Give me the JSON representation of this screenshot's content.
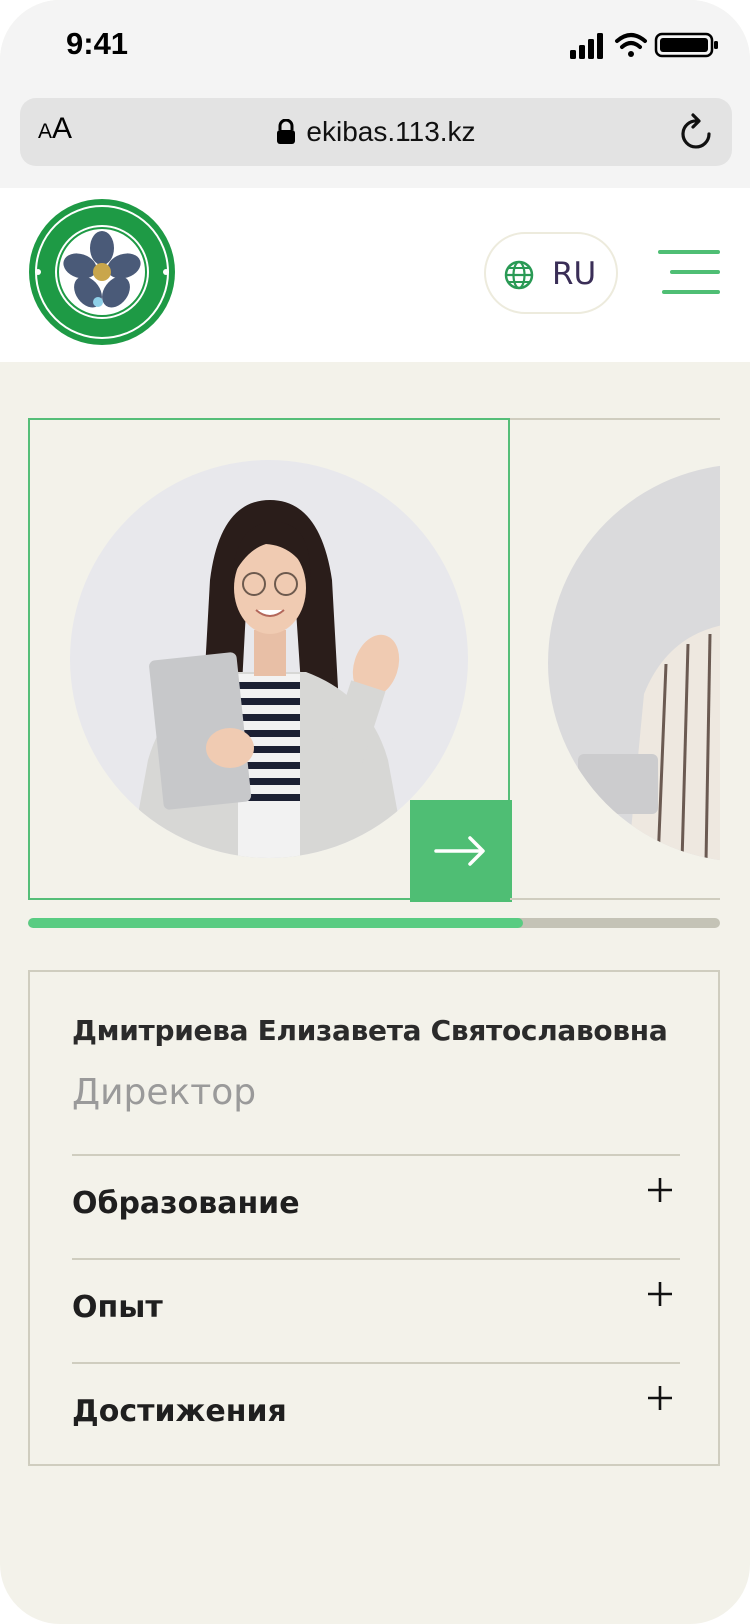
{
  "status": {
    "time": "9:41"
  },
  "browser": {
    "text_size_small": "A",
    "text_size_large": "A",
    "url": "ekibas.113.kz"
  },
  "header": {
    "logo_alt": "ҒЫЛЫМИ МЕКТЕП",
    "language": "RU"
  },
  "carousel": {
    "progress_fraction": 0.715
  },
  "person": {
    "name": "Дмитриева Елизавета Святославовна",
    "role": "Директор",
    "sections": [
      {
        "label": "Образование"
      },
      {
        "label": "Опыт"
      },
      {
        "label": "Достижения"
      }
    ]
  },
  "colors": {
    "accent": "#4FBE74",
    "background": "#F3F2EA",
    "border": "#CFCDBF"
  },
  "icons": [
    "signal-icon",
    "wifi-icon",
    "battery-icon",
    "lock-icon",
    "reload-icon",
    "globe-icon",
    "menu-icon",
    "arrow-right-icon",
    "plus-icon"
  ]
}
